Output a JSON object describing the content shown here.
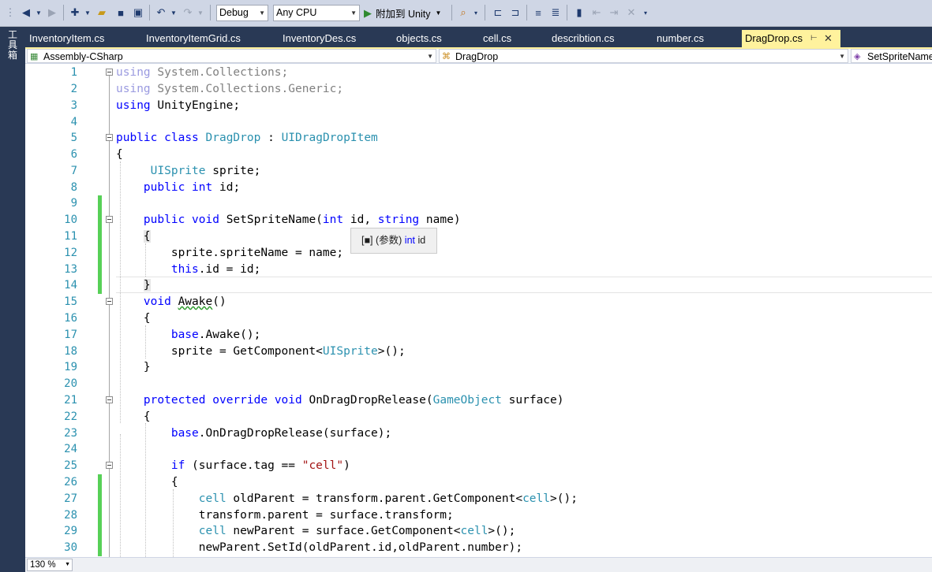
{
  "toolbar": {
    "config": "Debug",
    "platform": "Any CPU",
    "attach_label": "附加到 Unity",
    "icons": [
      "back-icon",
      "forward-icon",
      "new-project-icon",
      "open-icon",
      "save-icon",
      "save-all-icon",
      "undo-icon",
      "redo-icon",
      "find-icon",
      "comment-icon",
      "uncomment-icon",
      "indent-icon",
      "outdent-icon",
      "bookmark-icon",
      "prev-bookmark-icon",
      "next-bookmark-icon",
      "clear-bookmark-icon"
    ]
  },
  "left_panel": {
    "label": "工具箱"
  },
  "tabs": [
    {
      "label": "InventoryItem.cs",
      "active": false
    },
    {
      "label": "InventoryItemGrid.cs",
      "active": false
    },
    {
      "label": "InventoryDes.cs",
      "active": false
    },
    {
      "label": "objects.cs",
      "active": false
    },
    {
      "label": "cell.cs",
      "active": false
    },
    {
      "label": "describtion.cs",
      "active": false
    },
    {
      "label": "number.cs",
      "active": false
    },
    {
      "label": "DragDrop.cs",
      "active": true
    }
  ],
  "tab_active_pin": "⊢",
  "tab_active_close": "✕",
  "navbar": {
    "project": "Assembly-CSharp",
    "type": "DragDrop",
    "member": "SetSpriteName"
  },
  "code_lines": [
    {
      "n": "1"
    },
    {
      "n": "2"
    },
    {
      "n": "3"
    },
    {
      "n": "4"
    },
    {
      "n": "5"
    },
    {
      "n": "6"
    },
    {
      "n": "7"
    },
    {
      "n": "8"
    },
    {
      "n": "9"
    },
    {
      "n": "10"
    },
    {
      "n": "11"
    },
    {
      "n": "12"
    },
    {
      "n": "13"
    },
    {
      "n": "14"
    },
    {
      "n": "15"
    },
    {
      "n": "16"
    },
    {
      "n": "17"
    },
    {
      "n": "18"
    },
    {
      "n": "19"
    },
    {
      "n": "20"
    },
    {
      "n": "21"
    },
    {
      "n": "22"
    },
    {
      "n": "23"
    },
    {
      "n": "24"
    },
    {
      "n": "25"
    },
    {
      "n": "26"
    },
    {
      "n": "27"
    },
    {
      "n": "28"
    },
    {
      "n": "29"
    },
    {
      "n": "30"
    }
  ],
  "code_text": [
    "using System.Collections;",
    "using System.Collections.Generic;",
    "using UnityEngine;",
    "",
    "public class DragDrop : UIDragDropItem",
    "{",
    " UISprite sprite;",
    "public int id;",
    "",
    "public void SetSpriteName(int id, string name)",
    "{",
    "sprite.spriteName = name;",
    "this.id = id;",
    "}",
    "void Awake()",
    "{",
    "base.Awake();",
    "sprite = GetComponent<UISprite>();",
    "}",
    "",
    "protected override void OnDragDropRelease(GameObject surface)",
    "{",
    "base.OnDragDropRelease(surface);",
    "",
    "if (surface.tag == \"cell\")",
    "{",
    "cell oldParent = transform.parent.GetComponent<cell>();",
    "transform.parent = surface.transform;",
    "cell newParent = surface.GetComponent<cell>();",
    "newParent.SetId(oldParent.id,oldParent.number);"
  ],
  "tooltip": {
    "prefix": "(参数)",
    "type": "int",
    "name": "id"
  },
  "status": {
    "zoom": "130 %"
  }
}
